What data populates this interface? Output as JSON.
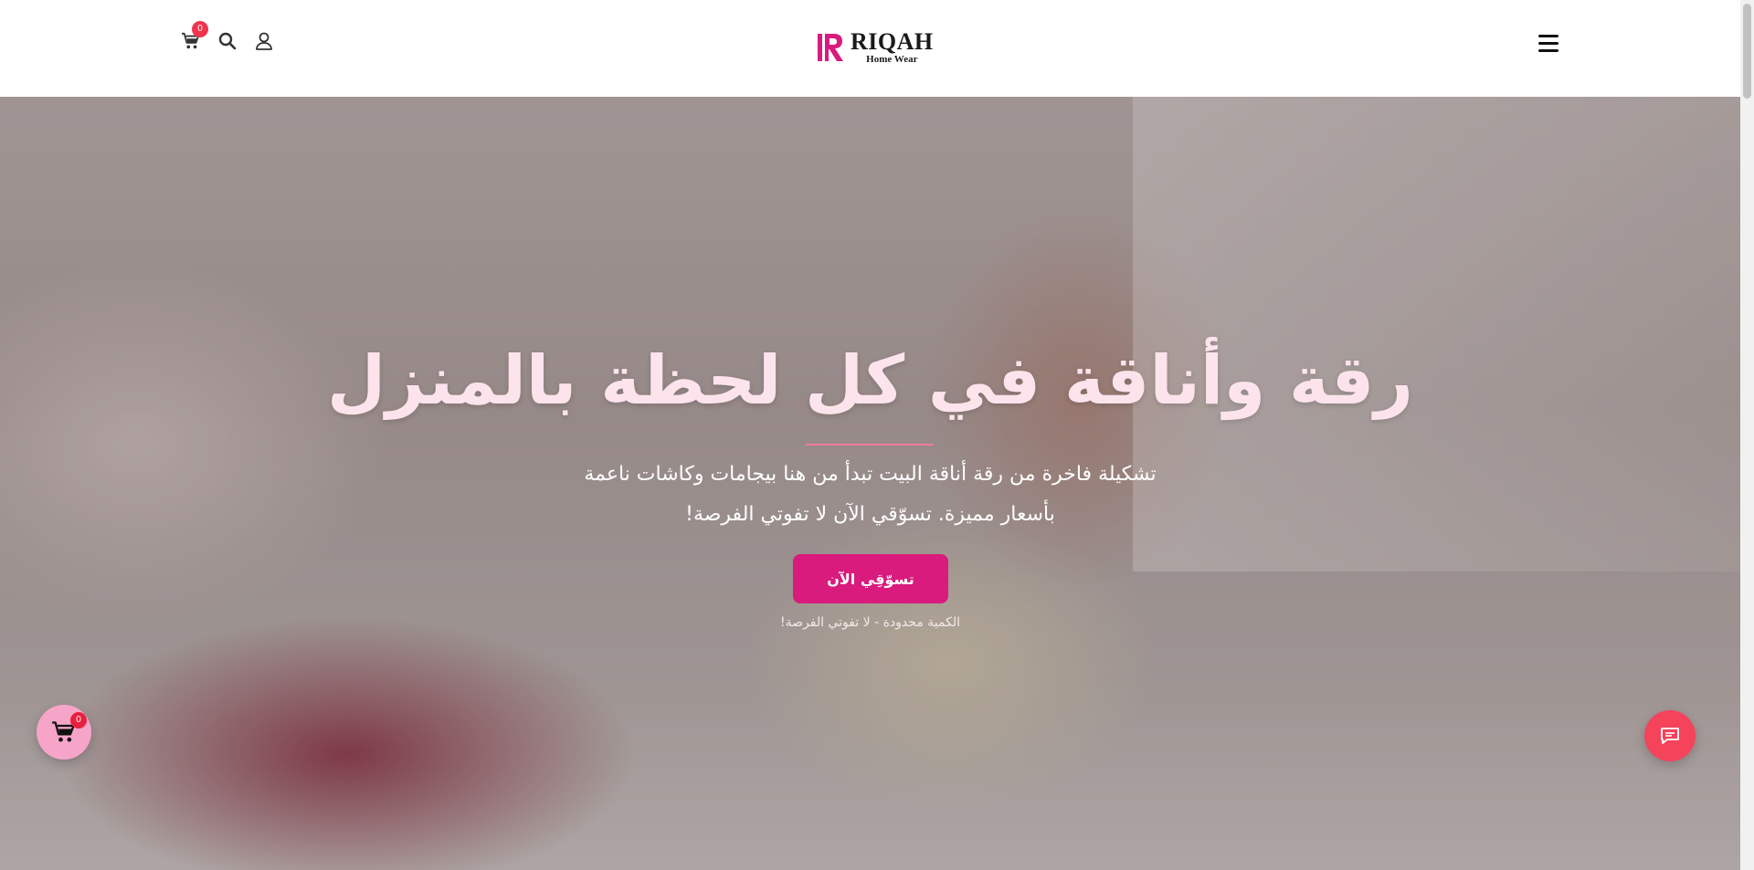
{
  "header": {
    "cart_count": "0",
    "brand_name": "RIQAH",
    "brand_sub": "Home Wear",
    "icons": [
      "cart-icon",
      "search-icon",
      "user-icon",
      "menu-icon"
    ]
  },
  "hero": {
    "title": "رقة وأناقة في كل لحظة بالمنزل",
    "description_line1": "تشكيلة فاخرة من رقة أناقة البيت تبدأ من هنا بيجامات وكاشات ناعمة",
    "description_line2": "بأسعار مميزة. تسوّقي الآن لا تفوتي الفرصة!",
    "cta_label": "تسوّقِي الآن",
    "cta_note": "الكمية محدودة - لا تفوتي الفرصة!"
  },
  "floating": {
    "cart_count": "0",
    "icons": [
      "cart-icon",
      "chat-icon"
    ]
  },
  "colors": {
    "accent": "#d81b7c",
    "badge": "#f0344e",
    "chat_button": "#f4435b",
    "float_cart": "#f7a4c9",
    "title": "#fde4ec"
  }
}
